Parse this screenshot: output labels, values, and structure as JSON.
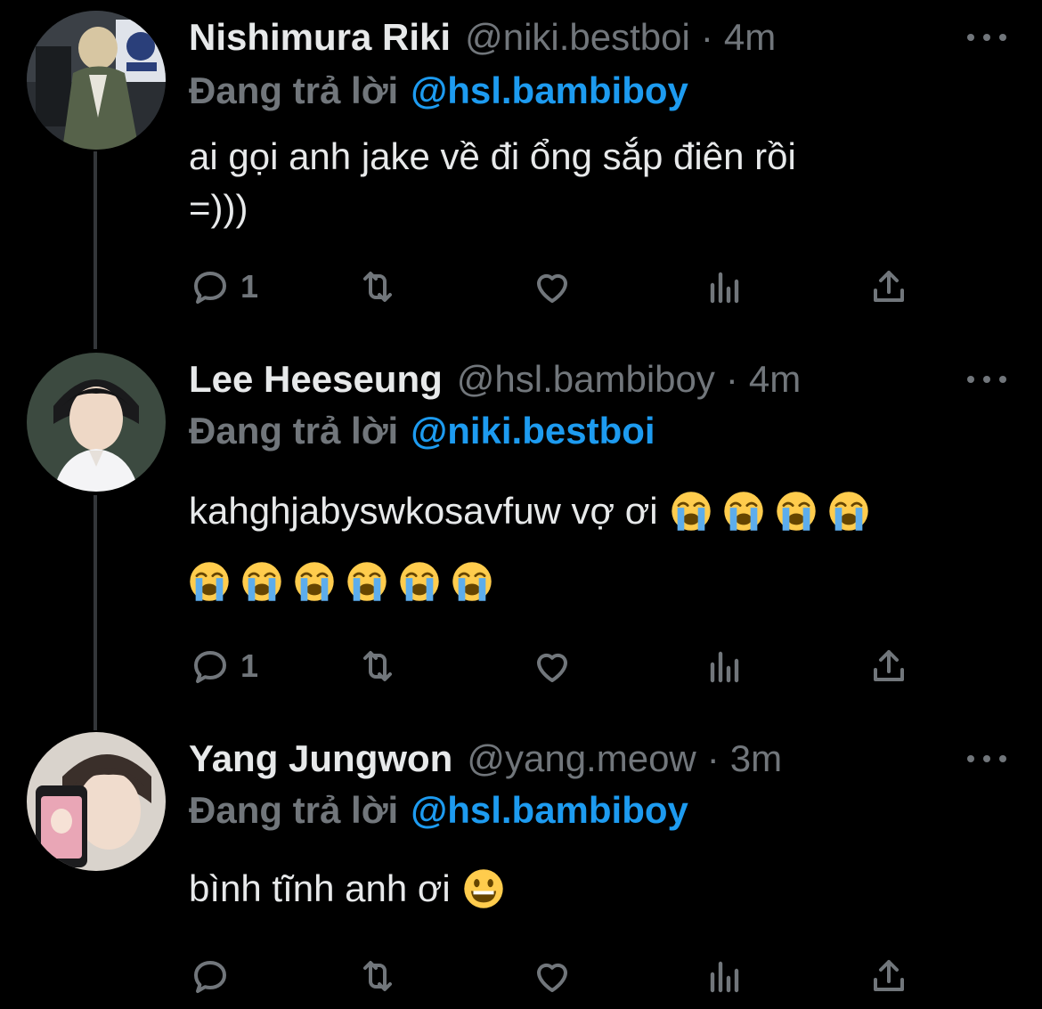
{
  "thread": {
    "tweets": [
      {
        "display_name": "Nishimura Riki",
        "handle": "@niki.bestboi",
        "dot": "·",
        "time": "4m",
        "reply_prefix": "Đang trả lời",
        "reply_mention": "@hsl.bambiboy",
        "text_lines": [
          "ai gọi anh jake về đi ổng sắp điên rồi",
          "=)))"
        ],
        "reply_count": "1"
      },
      {
        "display_name": "Lee Heeseung",
        "handle": "@hsl.bambiboy",
        "dot": "·",
        "time": "4m",
        "reply_prefix": "Đang trả lời",
        "reply_mention": "@niki.bestboi",
        "text": "kahghjabyswkosavfuw vợ ơi",
        "emoji": "loudly-crying-face",
        "emoji_count_line1": 4,
        "emoji_count_line2": 6,
        "reply_count": "1"
      },
      {
        "display_name": "Yang Jungwon",
        "handle": "@yang.meow",
        "dot": "·",
        "time": "3m",
        "reply_prefix": "Đang trả lời",
        "reply_mention": "@hsl.bambiboy",
        "text": "bình tĩnh anh ơi",
        "emoji": "grinning-face",
        "reply_count": ""
      }
    ]
  },
  "icons": {
    "reply": "reply-icon",
    "retweet": "retweet-icon",
    "like": "heart-icon",
    "views": "analytics-icon",
    "share": "share-icon",
    "more": "more-icon"
  },
  "colors": {
    "background": "#000000",
    "text": "#e7e9ea",
    "muted": "#71767b",
    "link": "#1d9bf0",
    "thread_line": "#333639"
  }
}
